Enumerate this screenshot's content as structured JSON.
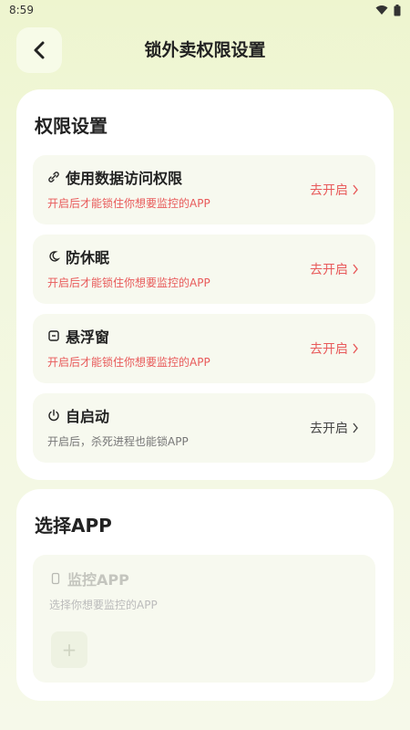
{
  "status_bar": {
    "time": "8:59"
  },
  "header": {
    "title": "锁外卖权限设置"
  },
  "permissions": {
    "title": "权限设置",
    "items": [
      {
        "title": "使用数据访问权限",
        "desc": "开启后才能锁住你想要监控的APP",
        "action": "去开启",
        "icon": "link-icon"
      },
      {
        "title": "防休眠",
        "desc": "开启后才能锁住你想要监控的APP",
        "action": "去开启",
        "icon": "moon-icon"
      },
      {
        "title": "悬浮窗",
        "desc": "开启后才能锁住你想要监控的APP",
        "action": "去开启",
        "icon": "window-icon"
      },
      {
        "title": "自启动",
        "desc": "开启后，杀死进程也能锁APP",
        "action": "去开启",
        "icon": "power-icon"
      }
    ]
  },
  "select_app": {
    "title": "选择APP",
    "monitor_title": "监控APP",
    "monitor_desc": "选择你想要监控的APP",
    "add_symbol": "+"
  },
  "colors": {
    "accent_red": "#e85a5a",
    "card_bg": "#f7f9ef"
  }
}
